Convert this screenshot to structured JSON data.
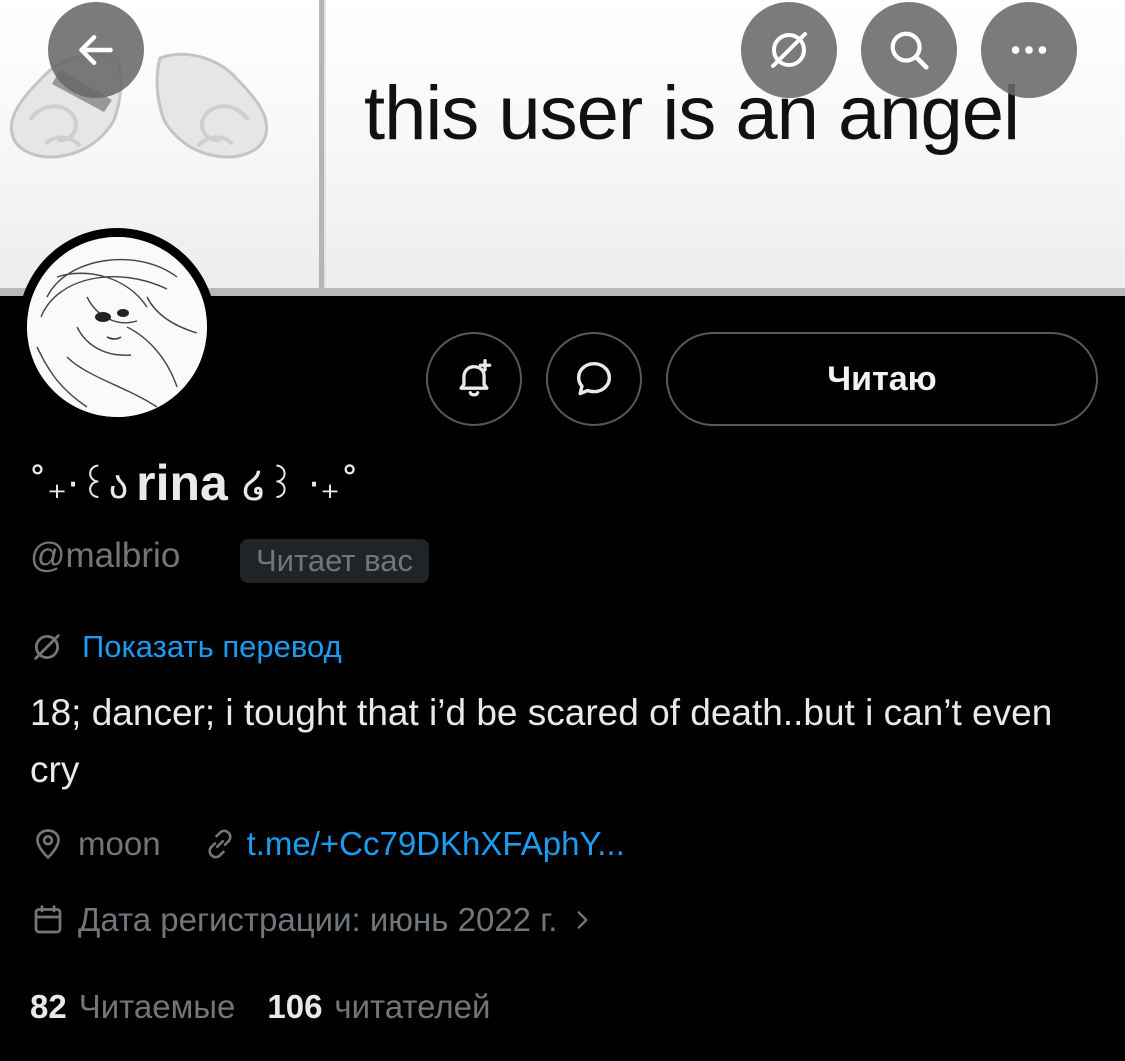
{
  "banner": {
    "text": "this user is an angel"
  },
  "header_buttons": {
    "back_icon": "arrow-left-icon",
    "translate_icon": "translate-off-icon",
    "search_icon": "search-icon",
    "more_icon": "more-horizontal-icon"
  },
  "profile": {
    "name_prefix": "˚₊‧꒰ა",
    "name": "rina",
    "name_suffix": "໒꒱ ‧₊˚",
    "handle": "@malbrio",
    "follows_you_badge": "Читает вас",
    "translate_link": "Показать перевод",
    "bio": "18; dancer; i tought that i’d be scared of death..but i can’t even cry",
    "location": "moon",
    "website": "t.me/+Cc79DKhXFAphY...",
    "joined": "Дата регистрации: июнь 2022 г.",
    "following_count": "82",
    "following_label": "Читаемые",
    "followers_count": "106",
    "followers_label": "читателей"
  },
  "actions": {
    "follow_button": "Читаю",
    "notify_icon": "bell-plus-icon",
    "message_icon": "chat-bubble-icon"
  },
  "colors": {
    "background": "#000000",
    "link": "#1d9bf0",
    "muted": "#71767b",
    "text": "#e7e9ea",
    "border": "#55595d"
  }
}
